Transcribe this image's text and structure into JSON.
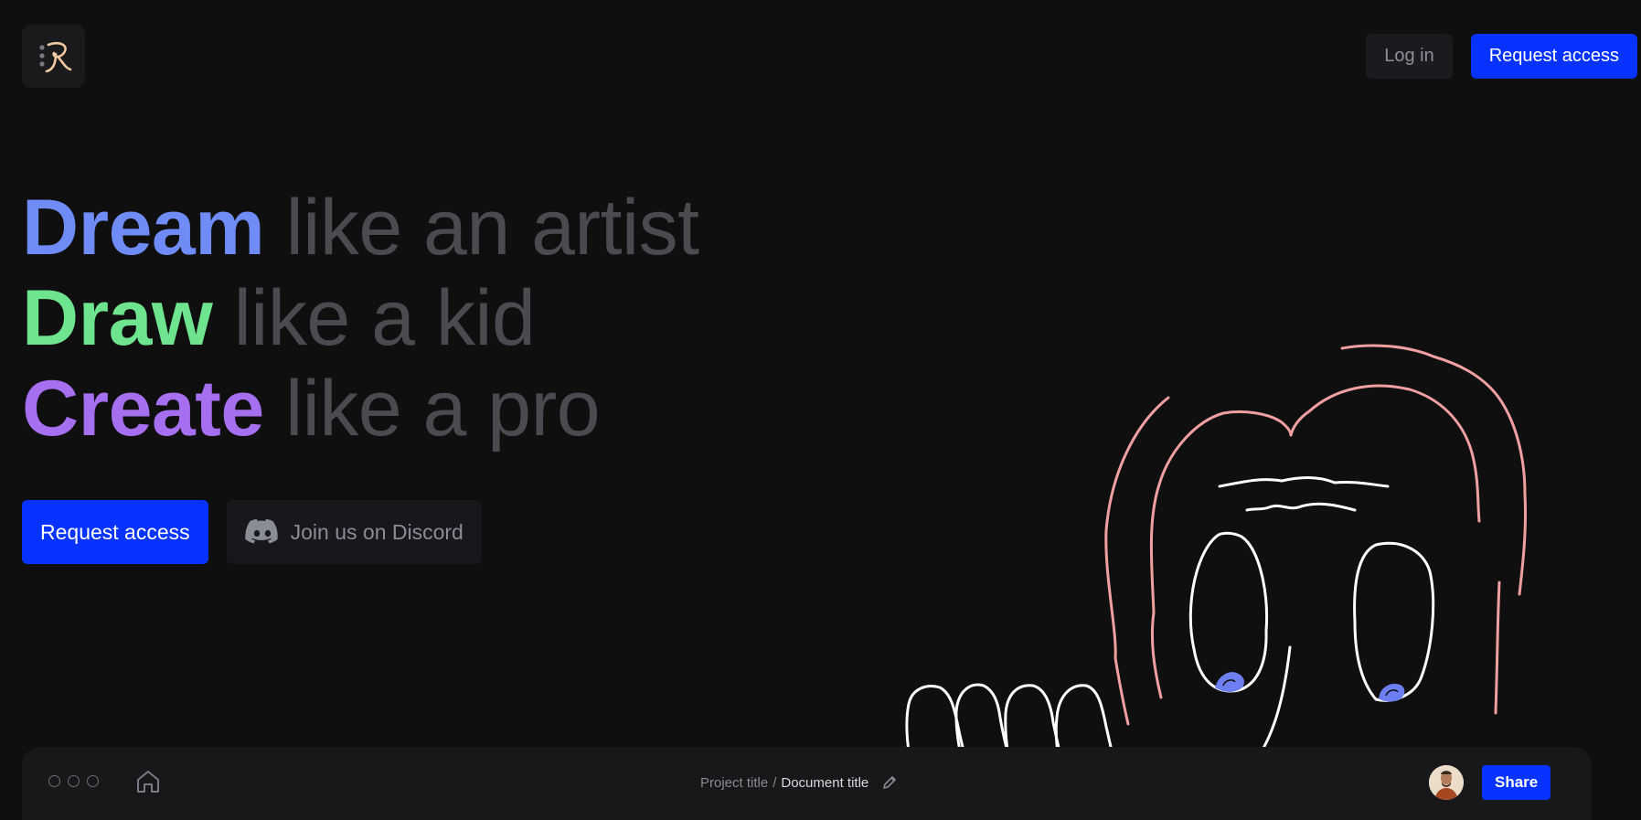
{
  "logo": {
    "icon": "r-monogram-logo-icon"
  },
  "nav": {
    "login_label": "Log in",
    "request_access_label": "Request access"
  },
  "hero": {
    "lines": [
      {
        "em": "Dream",
        "rest": "like an artist"
      },
      {
        "em": "Draw",
        "rest": "like a kid"
      },
      {
        "em": "Create",
        "rest": "like a pro"
      }
    ]
  },
  "cta": {
    "request_access_label": "Request access",
    "discord_label": "Join us on Discord",
    "discord_icon": "discord-icon"
  },
  "editor": {
    "project_title": "Project title",
    "separator": "/",
    "document_title": "Document title",
    "share_label": "Share"
  },
  "colors": {
    "accent": "#0633ff",
    "dream": "#6f8bf5",
    "draw": "#6fe48e",
    "create": "#a56ff0",
    "hair": "#f0a0a0",
    "pupil": "#6d7ff0"
  }
}
